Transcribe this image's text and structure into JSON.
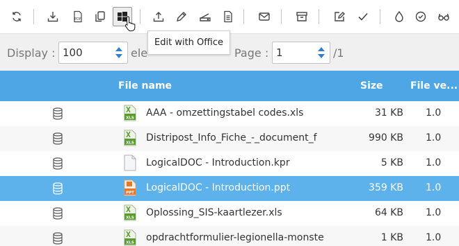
{
  "toolbar": {
    "buttons": [
      {
        "icon": "refresh-icon"
      },
      {
        "icon": "download-icon"
      },
      {
        "icon": "pdf-icon"
      },
      {
        "icon": "copy-icon"
      },
      {
        "icon": "windows-office-icon"
      },
      {
        "icon": "upload-icon"
      },
      {
        "icon": "pencil-icon"
      },
      {
        "icon": "scanner-icon"
      },
      {
        "icon": "document-icon"
      },
      {
        "icon": "envelope-icon"
      },
      {
        "icon": "archive-icon"
      },
      {
        "icon": "edit-icon"
      },
      {
        "icon": "check-icon"
      },
      {
        "icon": "drop-icon"
      },
      {
        "icon": "badge-check-icon"
      },
      {
        "icon": "glasses-icon"
      }
    ],
    "pdf_text": "PDF"
  },
  "tooltip": {
    "text": "Edit with Office"
  },
  "paging": {
    "display_label": "Display :",
    "display_value": "100",
    "elements_partial": "ele",
    "page_label": "Page :",
    "page_value": "1",
    "total_pages": "/1"
  },
  "grid": {
    "columns": {
      "name": "File name",
      "size": "Size",
      "version": "File ve..."
    },
    "rows": [
      {
        "name": "AAA - omzettingstabel codes.xls",
        "size": "31 KB",
        "version": "1.0",
        "type": "xls",
        "type_label": "XLS"
      },
      {
        "name": "Distripost_Info_Fiche_-_document_f",
        "size": "990 KB",
        "version": "1.0",
        "type": "xls",
        "type_label": "XLS"
      },
      {
        "name": "LogicalDOC - Introduction.kpr",
        "size": "5 KB",
        "version": "1.0",
        "type": "generic",
        "type_label": ""
      },
      {
        "name": "LogicalDOC - Introduction.ppt",
        "size": "359 KB",
        "version": "1.0",
        "type": "ppt",
        "type_label": "PPT",
        "selected": true
      },
      {
        "name": "Oplossing_SIS-kaartlezer.xls",
        "size": "64 KB",
        "version": "1.0",
        "type": "xls",
        "type_label": "XLS"
      },
      {
        "name": "opdrachtformulier-legionella-monste",
        "size": "1 KB",
        "version": "1.0",
        "type": "xls",
        "type_label": "XLS"
      }
    ]
  },
  "colors": {
    "header": "#4fa6e4",
    "selected": "#5eb2eb",
    "xls": "#5c9c2f",
    "ppt": "#e8772e",
    "spin": "#2f7fd0"
  }
}
